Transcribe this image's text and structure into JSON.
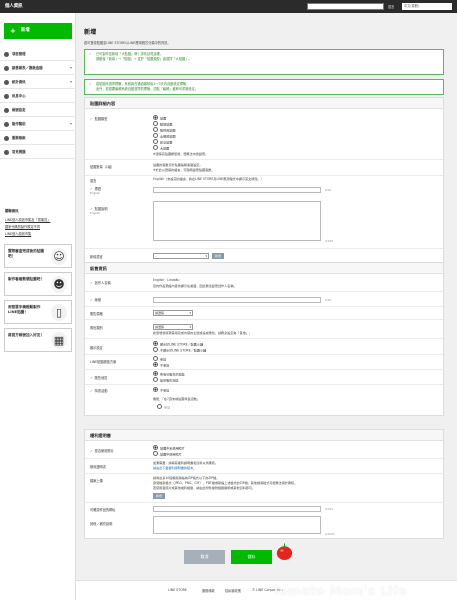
{
  "topbar": {
    "brand": "個人資訊",
    "lang_label": "語言",
    "lang_value": "中文(繁體)"
  },
  "sidebar": {
    "new_button": "新增",
    "items": [
      {
        "label": "項目管理",
        "chevron": ""
      },
      {
        "label": "銷售報表／匯款金額",
        "chevron": "▾"
      },
      {
        "label": "統計資訊",
        "chevron": "▾"
      },
      {
        "label": "訊息中心",
        "chevron": ""
      },
      {
        "label": "帳號設定",
        "chevron": ""
      },
      {
        "label": "製作幫助",
        "chevron": "▾"
      },
      {
        "label": "服務條款",
        "chevron": ""
      },
      {
        "label": "常見問題",
        "chevron": ""
      }
    ],
    "related_title": "關聯資訊",
    "related_links": [
      "LINE個人原創市集及「感謝賞」",
      "國家代碼的製作規定不同",
      "LINE個人原創市集"
    ],
    "promos": [
      {
        "text": "實際審查完成後的貼圖吧！",
        "icon": "☺"
      },
      {
        "text": "製作看看動態貼圖吧！",
        "icon": "☻"
      },
      {
        "text": "用智慧手機輕鬆製作LINE貼圖！",
        "icon": "▯"
      },
      {
        "text": "將官方帳號加入好友！",
        "icon": "▦"
      }
    ]
  },
  "main": {
    "title": "新增",
    "description": "若可登錄貼圖至LINE STORE以LINE應用程式分類中的資訊。",
    "notice1": [
      "已可製作並新增「大貼圖」唷！詳情請見這裡。",
      "調動後「新增」→「貼圖」→ 並於「貼圖類型」處選擇「大貼圖」。"
    ],
    "notice2": [
      "若貼圖未選擇標籤，系統將在通過審核後2～3天內自動設定標籤。",
      "此外，若想要編輯系統自動選擇的標籤，請點「編輯」鍵即可重新設定。"
    ]
  },
  "panel1": {
    "title": "貼圖詳細內容",
    "type_label": "貼圖類型",
    "type_options": [
      "貼圖",
      "動態貼圖",
      "隨附音貼圖",
      "全螢幕貼圖",
      "訊息貼圖",
      "大貼圖"
    ],
    "type_note": "※選擇完貼圖類型後，便無法中途變更。",
    "count_label": "貼圖數量（1組）",
    "count_note1": "貼圖的張數可於貼圖編輯畫面設定。",
    "count_note2": "※於此以選擇的語言，可隨時變更貼圖張數。",
    "lang_label": "語言",
    "lang_value": "English（未設定的語言，將在LINE STORE及LINE應用程式中顯示英文標題。）",
    "title_label": "標題",
    "title_sub": "English",
    "title_count": "0/40",
    "desc_label": "貼圖說明",
    "desc_sub": "English",
    "desc_count": "0/160",
    "add_lang_label": "新增語言",
    "add_lang_value": "-",
    "add_lang_button": "新增"
  },
  "panel2": {
    "title": "販售資訊",
    "creator_label": "創作人名稱",
    "creator_value": "English：LindaKu",
    "creator_note": "您的作品預設內容會顯示在畫面，因此無法變更創作人名稱。",
    "copyright_label": "版權",
    "copyright_count": "0/50",
    "price_label": "販售價格",
    "price_value": "請選擇",
    "role_label": "角色類別",
    "role_value": "請選擇",
    "role_note": "新型號會接受需用完成內容的主題或是或角色，請務必設定為「其他」。",
    "show_label": "顯示設定",
    "show_options": [
      "顯示於LINE STORE／貼圖小舖",
      "不顯示於LINE STORE／貼圖小舖"
    ],
    "tag_label": "LINE貼圖超值方案",
    "tag_options": [
      "參加",
      "不參加"
    ],
    "region_label": "販售地區",
    "region_options": [
      "所有可販售的地區",
      "設定販售地區"
    ],
    "event_label": "特賣活動",
    "event_options": [
      "不參加"
    ],
    "event_note": "機能：「在7週末前貼圖特賣活動」",
    "event_extra": "參加"
  },
  "panel3": {
    "title": "權利證明書",
    "need_label": "是否使用照片",
    "need_options": [
      "貼圖中未使用照片",
      "貼圖中使用照片"
    ],
    "cert_label": "權利證明書",
    "cert_note1": "如果需要，請填寫權利證明書和資料以供審核。",
    "cert_note2": "請由此下載權利證明書的範本。",
    "upload_label": "檔案上傳",
    "upload_note1": "請將最多10個檔案壓縮為ZIP格式以下的ZIP檔。",
    "upload_note2": "接受檔案格式（JPEG、PNG、GIF）、PDF檔或壓縮上述格式的ZIP檔。其他檔案格式可能無法用於審核。",
    "upload_note3": "若使用者照片或其他權利相關，請由此附件檔附相關證明或其他資料即可。",
    "upload_button": "新增",
    "url_label": "可確認作品的網址",
    "url_count": "0/255",
    "other_label": "其他／補充說明",
    "other_count": "0/2000"
  },
  "actions": {
    "cancel": "取消",
    "save": "儲存"
  },
  "footer": {
    "links": [
      "LINE STORE",
      "服務條款",
      "隱私權政策"
    ],
    "copyright": "© LINE Corporation",
    "watermark": "Tomato Mom's Life"
  }
}
